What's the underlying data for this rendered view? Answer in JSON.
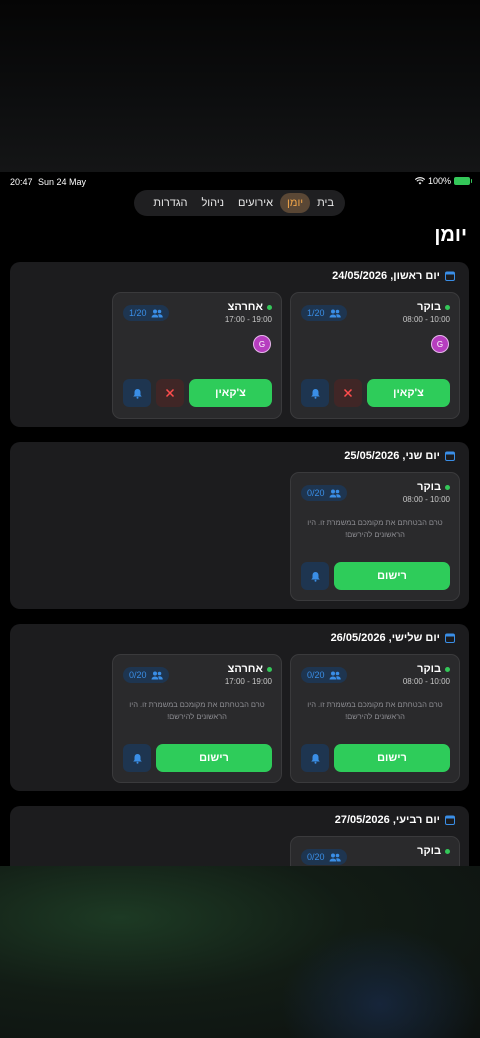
{
  "status": {
    "time": "20:47",
    "date": "Sun 24 May",
    "battery": "100%"
  },
  "nav": {
    "items": [
      "בית",
      "יומן",
      "אירועים",
      "ניהול",
      "הגדרות"
    ],
    "active_index": 1
  },
  "page": {
    "title": "יומן"
  },
  "days": [
    {
      "title": "יום ראשון, 24/05/2026",
      "shifts": [
        {
          "name": "בוקר",
          "time": "08:00 - 10:00",
          "count": "1/20",
          "avatar": "G",
          "action": "צ'קאין",
          "empty": "",
          "has_cancel": true
        },
        {
          "name": "אחרהצ",
          "time": "17:00 - 19:00",
          "count": "1/20",
          "avatar": "G",
          "action": "צ'קאין",
          "empty": "",
          "has_cancel": true
        }
      ]
    },
    {
      "title": "יום שני, 25/05/2026",
      "shifts": [
        {
          "name": "בוקר",
          "time": "08:00 - 10:00",
          "count": "0/20",
          "avatar": "",
          "action": "רישום",
          "empty": "טרם הבטחתם את מקומכם במשמרת זו. היו הראשונים להירשם!",
          "has_cancel": false
        }
      ]
    },
    {
      "title": "יום שלישי, 26/05/2026",
      "shifts": [
        {
          "name": "בוקר",
          "time": "08:00 - 10:00",
          "count": "0/20",
          "avatar": "",
          "action": "רישום",
          "empty": "טרם הבטחתם את מקומכם במשמרת זו. היו הראשונים להירשם!",
          "has_cancel": false
        },
        {
          "name": "אחרהצ",
          "time": "17:00 - 19:00",
          "count": "0/20",
          "avatar": "",
          "action": "רישום",
          "empty": "טרם הבטחתם את מקומכם במשמרת זו. היו הראשונים להירשם!",
          "has_cancel": false
        }
      ]
    },
    {
      "title": "יום רביעי, 27/05/2026",
      "shifts": [
        {
          "name": "בוקר",
          "time": "",
          "count": "0/20",
          "avatar": "",
          "action": "",
          "empty": "",
          "has_cancel": false
        }
      ]
    }
  ],
  "icons": {
    "calendar": "calendar-icon",
    "people": "people-icon",
    "bell": "bell-icon",
    "cancel": "close-icon"
  },
  "colors": {
    "accent_green": "#2ecc5a",
    "accent_blue": "#3a8ee6",
    "nav_active": "#f0a54a",
    "avatar": "#b63dbf"
  }
}
